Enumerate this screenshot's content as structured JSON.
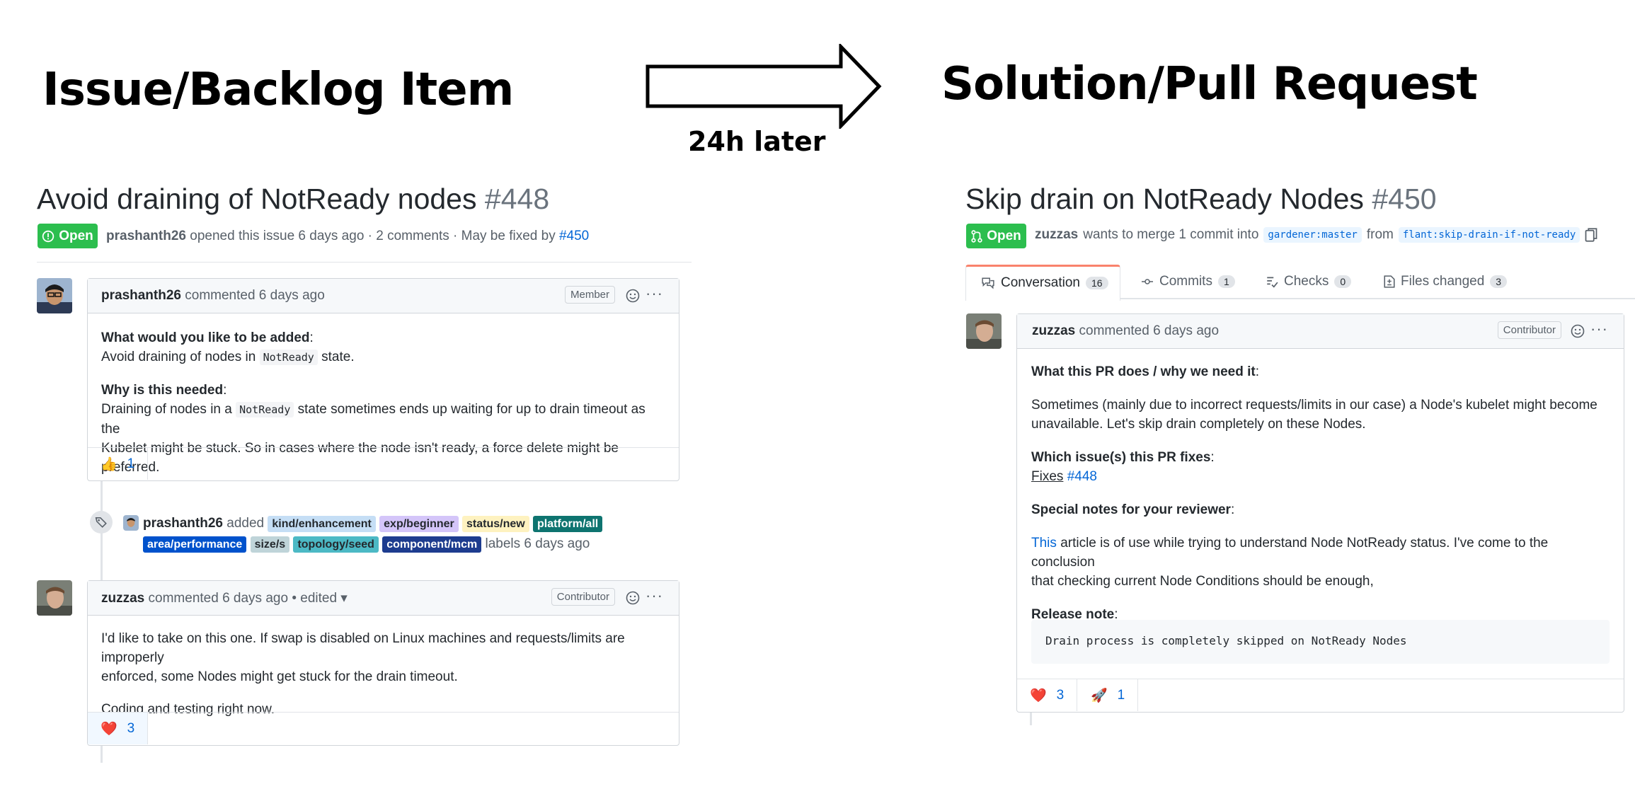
{
  "left_heading": "Issue/Backlog Item",
  "right_heading": "Solution/Pull Request",
  "arrow_label": "24h later",
  "issue": {
    "title": "Avoid draining of NotReady nodes",
    "number": "#448",
    "state": "Open",
    "author": "prashanth26",
    "meta_rest": "opened this issue 6 days ago · 2 comments · May be fixed by",
    "fixed_by": "#450",
    "comment1": {
      "author": "prashanth26",
      "when": "commented 6 days ago",
      "role": "Member",
      "q1": "What would you like to be added",
      "a1_pre": "Avoid draining of nodes in",
      "a1_code": "NotReady",
      "a1_post": "state.",
      "q2": "Why is this needed",
      "a2_pre": "Draining of nodes in a",
      "a2_code": "NotReady",
      "a2_post": "state sometimes ends up waiting for up to drain timeout as the",
      "a2_line2": "Kubelet might be stuck. So in cases where the node isn't ready, a force delete might be preferred.",
      "reaction_emoji": "👍",
      "reaction_count": "1"
    },
    "event": {
      "actor": "prashanth26",
      "verb": "added",
      "labels": [
        "kind/enhancement",
        "exp/beginner",
        "status/new",
        "platform/all",
        "area/performance",
        "size/s",
        "topology/seed",
        "component/mcm"
      ],
      "label_colors": [
        "#c5def5",
        "#d4c5f9",
        "#fef2c0",
        "#0e7470",
        "#0052cc",
        "#bfd4d9",
        "#4cb9c5",
        "#1d3c8f"
      ],
      "label_text_colors": [
        "#24292e",
        "#24292e",
        "#24292e",
        "#ffffff",
        "#ffffff",
        "#24292e",
        "#24292e",
        "#ffffff"
      ],
      "suffix": "labels 6 days ago"
    },
    "comment2": {
      "author": "zuzzas",
      "when": "commented 6 days ago",
      "edited": "• edited ▾",
      "role": "Contributor",
      "line1": "I'd like to take on this one. If swap is disabled on Linux machines and requests/limits are improperly",
      "line2": "enforced, some Nodes might get stuck for the drain timeout.",
      "line3": "Coding and testing right now.",
      "reaction_emoji": "❤️",
      "reaction_count": "3"
    }
  },
  "pr": {
    "title": "Skip drain on NotReady Nodes",
    "number": "#450",
    "state": "Open",
    "author": "zuzzas",
    "meta_mid": "wants to merge 1 commit into",
    "base": "gardener:master",
    "from": "from",
    "head": "flant:skip-drain-if-not-ready",
    "tabs": [
      {
        "label": "Conversation",
        "count": "16"
      },
      {
        "label": "Commits",
        "count": "1"
      },
      {
        "label": "Checks",
        "count": "0"
      },
      {
        "label": "Files changed",
        "count": "3"
      }
    ],
    "comment": {
      "author": "zuzzas",
      "when": "commented 6 days ago",
      "role": "Contributor",
      "h1": "What this PR does / why we need it",
      "p1_line1": "Sometimes (mainly due to incorrect requests/limits in our case) a Node's kubelet might become",
      "p1_line2": "unavailable. Let's skip drain completely on these Nodes.",
      "h2": "Which issue(s) this PR fixes",
      "fixes": "Fixes",
      "fixes_ref": "#448",
      "h3": "Special notes for your reviewer",
      "p3_link": "This",
      "p3_line1": "article is of use while trying to understand Node NotReady status. I've come to the conclusion",
      "p3_line2": "that checking current Node Conditions should be enough,",
      "h4": "Release note",
      "release_note": "Drain process is completely skipped on NotReady Nodes",
      "reactions": [
        {
          "emoji": "❤️",
          "count": "3"
        },
        {
          "emoji": "🚀",
          "count": "1"
        }
      ]
    }
  }
}
